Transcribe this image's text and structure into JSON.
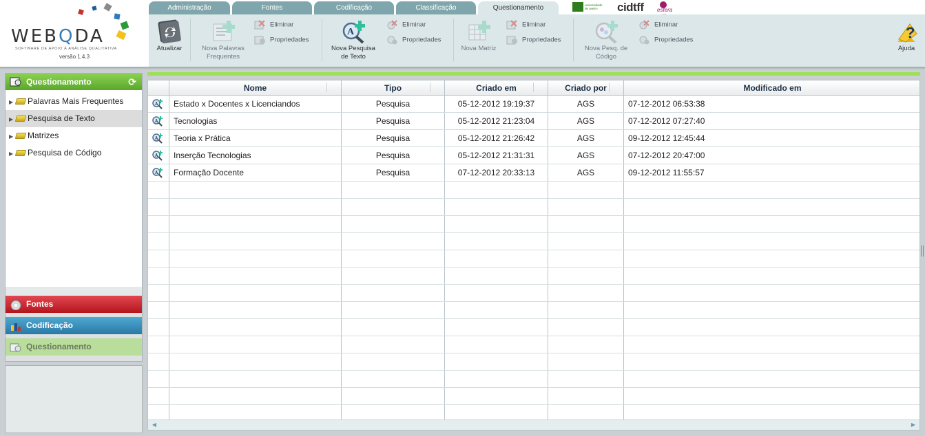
{
  "app": {
    "name_prefix": "WEB",
    "name_q": "Q",
    "name_suffix": "DA",
    "tagline": "SOFTWARE DE APOIO À ANÁLISE QUALITATIVA",
    "version": "versão 1.4.3"
  },
  "tabs": [
    {
      "label": "Administração",
      "active": false
    },
    {
      "label": "Fontes",
      "active": false
    },
    {
      "label": "Codificação",
      "active": false
    },
    {
      "label": "Classificação",
      "active": false
    },
    {
      "label": "Questionamento",
      "active": true
    }
  ],
  "partners": {
    "ua": "universidade de aveiro",
    "cidtff": "cidtff",
    "ec": "esfera crítica"
  },
  "ribbon": {
    "atualizar": "Atualizar",
    "nova_palavras_1": "Nova Palavras",
    "nova_palavras_2": "Frequentes",
    "eliminar": "Eliminar",
    "propriedades": "Propriedades",
    "nova_pesquisa_1": "Nova Pesquisa",
    "nova_pesquisa_2": "de Texto",
    "nova_matriz": "Nova Matriz",
    "nova_pesq_cod_1": "Nova Pesq. de",
    "nova_pesq_cod_2": "Código",
    "ajuda": "Ajuda"
  },
  "sidebar": {
    "header": "Questionamento",
    "items": [
      {
        "label": "Palavras Mais Frequentes",
        "selected": false
      },
      {
        "label": "Pesquisa de Texto",
        "selected": true
      },
      {
        "label": "Matrizes",
        "selected": false
      },
      {
        "label": "Pesquisa de Código",
        "selected": false
      }
    ],
    "accordion": [
      "Fontes",
      "Codificação",
      "Questionamento"
    ]
  },
  "grid": {
    "columns": [
      "Nome",
      "Tipo",
      "Criado em",
      "Criado por",
      "Modificado em"
    ],
    "rows": [
      {
        "nome": "Estado x Docentes x Licenciandos",
        "tipo": "Pesquisa",
        "criado_em": "05-12-2012 19:19:37",
        "criado_por": "AGS",
        "modificado_em": "07-12-2012 06:53:38"
      },
      {
        "nome": "Tecnologias",
        "tipo": "Pesquisa",
        "criado_em": "05-12-2012 21:23:04",
        "criado_por": "AGS",
        "modificado_em": "07-12-2012 07:27:40"
      },
      {
        "nome": "Teoria x Prática",
        "tipo": "Pesquisa",
        "criado_em": "05-12-2012 21:26:42",
        "criado_por": "AGS",
        "modificado_em": "09-12-2012 12:45:44"
      },
      {
        "nome": "Inserção Tecnologias",
        "tipo": "Pesquisa",
        "criado_em": "05-12-2012 21:31:31",
        "criado_por": "AGS",
        "modificado_em": "07-12-2012 20:47:00"
      },
      {
        "nome": "Formação Docente",
        "tipo": "Pesquisa",
        "criado_em": "07-12-2012 20:33:13",
        "criado_por": "AGS",
        "modificado_em": "09-12-2012 11:55:57"
      }
    ]
  },
  "colors": {
    "tab": "#7fa6ac",
    "ribbon": "#dbe7e8",
    "green_header": "#5aa72a",
    "fontes_red": "#b3151d",
    "codificacao_blue": "#2a79a5",
    "accent_bar": "#9fe05a"
  },
  "icons": {
    "atualizar": "refresh-icon",
    "nova_palavras": "word-frequency-icon",
    "nova_pesquisa": "text-search-icon",
    "nova_matriz": "matrix-icon",
    "nova_pesq_cod": "code-search-icon",
    "eliminar": "delete-icon",
    "propriedades": "properties-icon",
    "ajuda": "help-icon",
    "row": "text-search-icon"
  }
}
